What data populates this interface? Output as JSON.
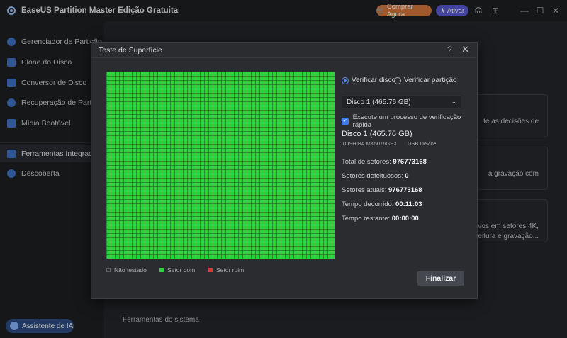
{
  "app": {
    "title": "EaseUS Partition Master Edição Gratuita",
    "buy_label": "Comprar Agora",
    "activate_label": "Ativar"
  },
  "sidebar": {
    "items": [
      {
        "label": "Gerenciador de Partição"
      },
      {
        "label": "Clone do Disco"
      },
      {
        "label": "Conversor de Disco"
      },
      {
        "label": "Recuperação de Partição"
      },
      {
        "label": "Mídia Bootável"
      },
      {
        "label": "Ferramentas Integradas",
        "active": true
      },
      {
        "label": "Descoberta"
      }
    ],
    "assistant_label": "Assistente de IA"
  },
  "background": {
    "card1_text": "te as decisões de",
    "card2_text": "a gravação com",
    "card3_line1": "quivos em setores 4K,",
    "card3_line2": "de leitura e gravação...",
    "footer_text": "Ferramentas do sistema"
  },
  "dialog": {
    "title": "Teste de Superfície",
    "help": "?",
    "close": "✕",
    "radio_disk": "Verificar disco",
    "radio_partition": "Verificar partição",
    "selected_disk": "Disco 1 (465.76 GB)",
    "quick_check_label": "Execute um processo de verificação rápida",
    "quick_check_checked": true,
    "disk_name": "Disco 1 (465.76 GB)",
    "disk_model": "TOSHIBA  MK5076GSX",
    "disk_type": "USB Device",
    "stats": [
      {
        "label": "Total de setores:",
        "value": "976773168"
      },
      {
        "label": "Setores defeituosos:",
        "value": "0"
      },
      {
        "label": "Setores atuais:",
        "value": "976773168"
      },
      {
        "label": "Tempo decorrido:",
        "value": "00:11:03"
      },
      {
        "label": "Tempo restante:",
        "value": "00:00:00"
      }
    ],
    "legend": [
      {
        "label": "Não testado",
        "color": "#2a2c30"
      },
      {
        "label": "Setor bom",
        "color": "#2bd43b"
      },
      {
        "label": "Setor ruim",
        "color": "#d33a3a"
      }
    ],
    "finish_label": "Finalizar"
  },
  "colors": {
    "accent": "#3f7be8",
    "good_sector": "#2bd43b",
    "bad_sector": "#d33a3a",
    "buy_button": "#d5773c",
    "activate_button": "#5a5ad6"
  }
}
